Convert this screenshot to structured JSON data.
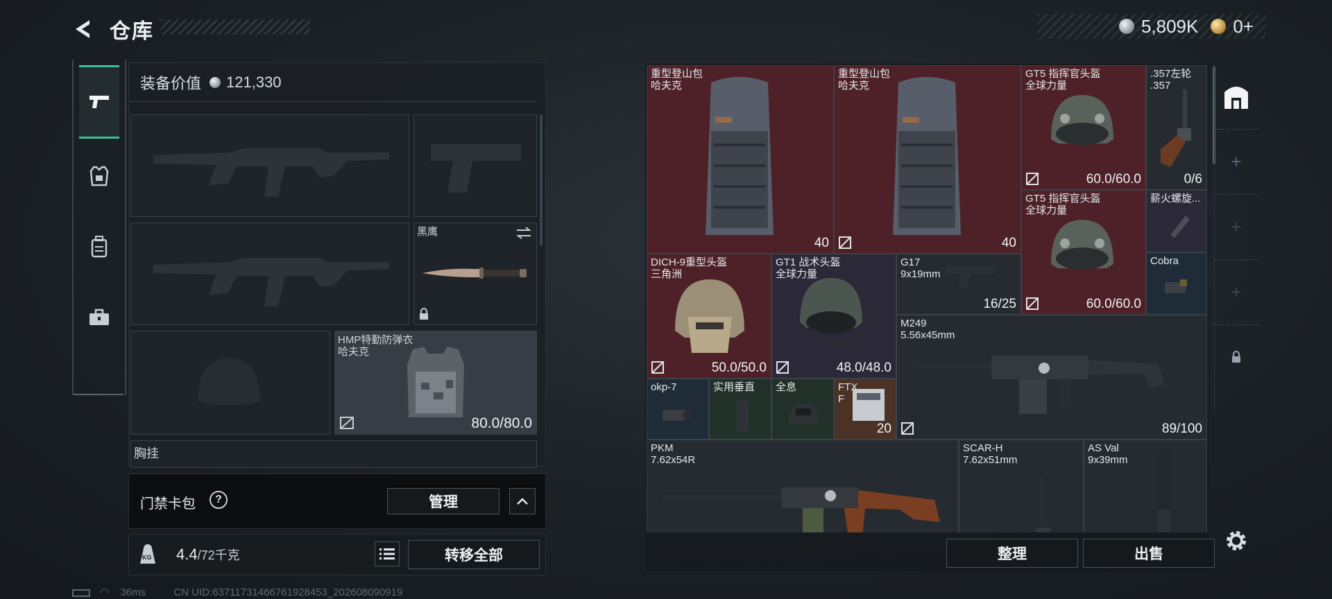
{
  "header": {
    "title": "仓库",
    "currency_silver": "5,809K",
    "currency_gold": "0+"
  },
  "tabs": [
    {
      "name": "weapons",
      "icon": "pistol-icon",
      "active": true
    },
    {
      "name": "armor",
      "icon": "armor-icon",
      "active": false
    },
    {
      "name": "backpack",
      "icon": "backpack-icon",
      "active": false
    },
    {
      "name": "toolbox",
      "icon": "toolbox-icon",
      "active": false
    }
  ],
  "equipment": {
    "value_label": "装备价值",
    "value": "121,330",
    "secondary_weapon_name": "黑鹰",
    "armor_name": "HMP特勤防弹衣",
    "armor_brand": "哈夫克",
    "armor_durability": "80.0/80.0",
    "chest_rig_label": "胸挂"
  },
  "gate_bag": {
    "label": "门禁卡包",
    "help": "?",
    "manage": "管理"
  },
  "weight": {
    "current": "4.4",
    "max": "/72千克",
    "kg_label": "KG",
    "transfer_all": "转移全部"
  },
  "stash_items": [
    {
      "name": "重型登山包",
      "sub": "哈夫克",
      "value": "40"
    },
    {
      "name": "重型登山包",
      "sub": "哈夫克",
      "value": "40"
    },
    {
      "name": "GT5 指挥官头盔",
      "sub": "全球力量",
      "value": "60.0/60.0"
    },
    {
      "name": ".357左轮",
      "sub": ".357",
      "value": "0/6"
    },
    {
      "name": "GT5 指挥官头盔",
      "sub": "全球力量",
      "value": "60.0/60.0"
    },
    {
      "name": "薪火螺旋...",
      "sub": "",
      "value": ""
    },
    {
      "name": "DICH-9重型头盔",
      "sub": "三角洲",
      "value": "50.0/50.0"
    },
    {
      "name": "GT1 战术头盔",
      "sub": "全球力量",
      "value": "48.0/48.0"
    },
    {
      "name": "G17",
      "sub": "9x19mm",
      "value": "16/25"
    },
    {
      "name": "Cobra",
      "sub": "",
      "value": ""
    },
    {
      "name": "M249",
      "sub": "5.56x45mm",
      "value": "89/100"
    },
    {
      "name": "okp-7",
      "sub": "",
      "value": ""
    },
    {
      "name": "实用垂直",
      "sub": "",
      "value": ""
    },
    {
      "name": "全息",
      "sub": "",
      "value": ""
    },
    {
      "name": "FTX",
      "sub": "F",
      "value": "20"
    },
    {
      "name": "PKM",
      "sub": "7.62x54R",
      "value": ""
    },
    {
      "name": "SCAR-H",
      "sub": "7.62x51mm",
      "value": ""
    },
    {
      "name": "AS Val",
      "sub": "9x39mm",
      "value": ""
    }
  ],
  "actions": {
    "sort": "整理",
    "sell": "出售"
  },
  "status": {
    "ping": "36ms",
    "uid": "CN UID:6371173146676192845​3_202608090919"
  }
}
